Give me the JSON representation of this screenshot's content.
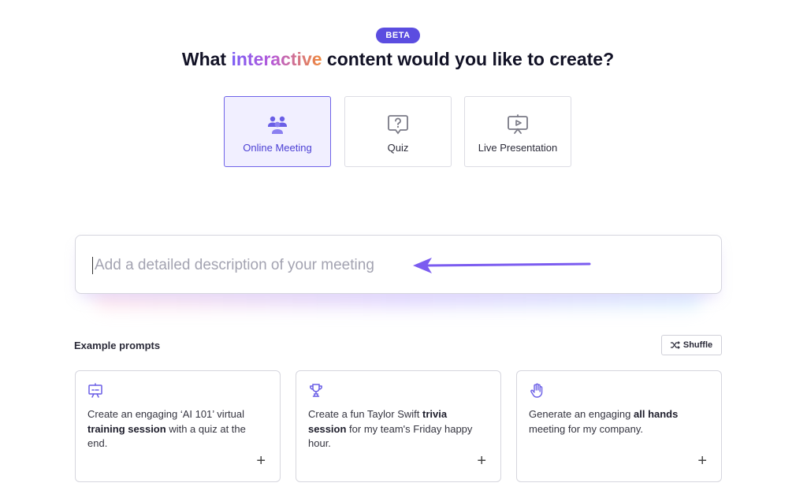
{
  "badge": "BETA",
  "heading": {
    "prefix": "What ",
    "highlight": "interactive",
    "suffix": " content would you like to create?"
  },
  "types": [
    {
      "label": "Online Meeting",
      "icon": "people-icon",
      "selected": true
    },
    {
      "label": "Quiz",
      "icon": "question-bubble-icon",
      "selected": false
    },
    {
      "label": "Live Presentation",
      "icon": "presentation-screen-icon",
      "selected": false
    }
  ],
  "description": {
    "placeholder": "Add a detailed description of your meeting",
    "value": ""
  },
  "examples": {
    "title": "Example prompts",
    "shuffle_label": "Shuffle",
    "prompts": [
      {
        "icon": "easel-icon",
        "t1": "Create an engaging ‘AI 101’ virtual ",
        "b1": "training session",
        "t2": " with a quiz at the end."
      },
      {
        "icon": "trophy-icon",
        "t1": "Create a fun Taylor Swift ",
        "b1": "trivia session",
        "t2": " for my team's Friday happy hour."
      },
      {
        "icon": "raised-hand-icon",
        "t1": "Generate an engaging ",
        "b1": "all hands",
        "t2": " meeting for my company."
      }
    ]
  },
  "colors": {
    "accent": "#5b4de0",
    "arrow": "#7b5cf0"
  }
}
